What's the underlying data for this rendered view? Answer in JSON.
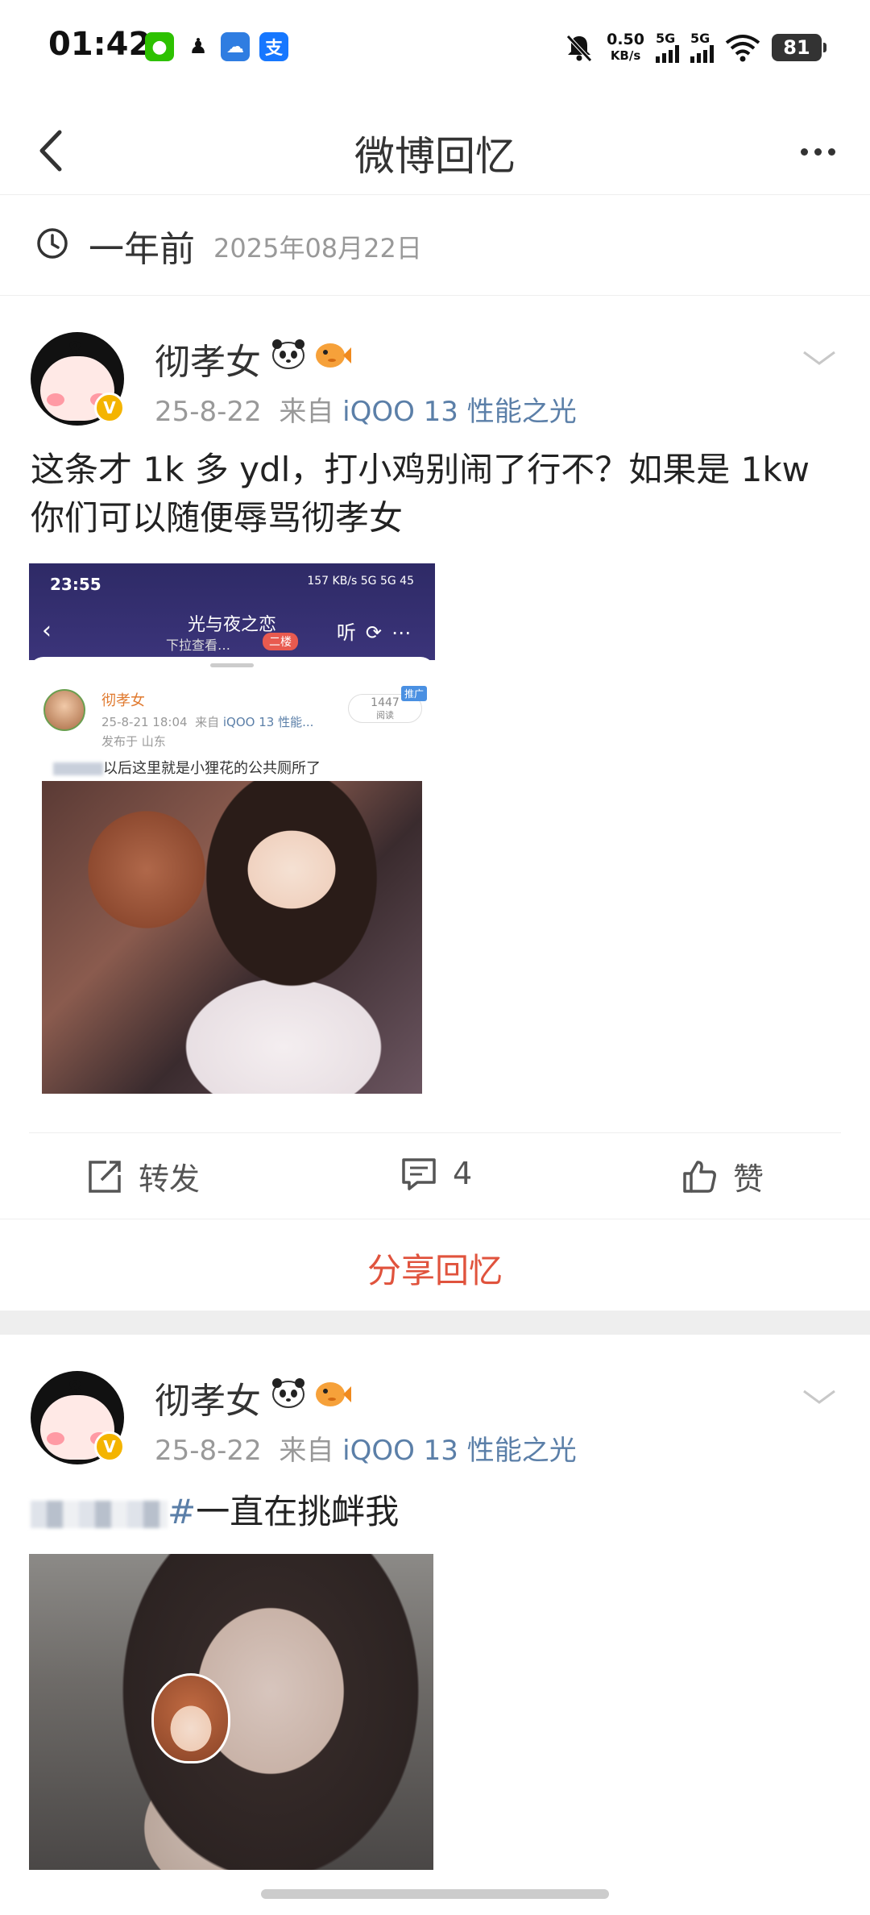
{
  "status_bar": {
    "time": "01:42",
    "net_speed_value": "0.50",
    "net_speed_unit": "KB/s",
    "sim1_label": "5G",
    "sim2_label": "5G",
    "battery": "81"
  },
  "header": {
    "title": "微博回忆"
  },
  "memory": {
    "label": "一年前",
    "date": "2025年08月22日"
  },
  "posts": [
    {
      "username": "彻孝女",
      "date": "25-8-22",
      "from_label": "来自",
      "source": "iQOO 13 性能之光",
      "text_line1": "这条才 1k 多 ydl，打小鸡别闹了行不？如果是 1kw",
      "text_line2": "你们可以随便辱骂彻孝女",
      "embedded": {
        "time": "23:55",
        "status": "157 KB/s 5G 5G 45",
        "title": "光与夜之恋",
        "subtitle": "下拉查看…",
        "tag": "二楼",
        "listen": "听",
        "user": "彻孝女",
        "meta_time": "25-8-21 18:04",
        "meta_from": "来自",
        "meta_source": "iQOO 13 性能...",
        "location": "发布于 山东",
        "reads_value": "1447",
        "reads_label": "阅读",
        "promo": "推广",
        "body": "以后这里就是小狸花的公共厕所了"
      },
      "actions": {
        "repost": "转发",
        "comments": "4",
        "like": "赞"
      }
    },
    {
      "username": "彻孝女",
      "date": "25-8-22",
      "from_label": "来自",
      "source": "iQOO 13 性能之光",
      "hashtag_end": "#",
      "text": "一直在挑衅我"
    }
  ],
  "share": {
    "label": "分享回忆"
  },
  "colors": {
    "accent_red": "#e0533d",
    "link_blue": "#5b7fa8",
    "muted": "#999999",
    "verified_badge": "#f4b400"
  },
  "icons": [
    "back-icon",
    "more-icon",
    "clock-icon",
    "chevron-down-icon",
    "repost-icon",
    "comment-icon",
    "like-icon",
    "verified-icon",
    "panda-emoji-icon",
    "fish-emoji-icon"
  ]
}
